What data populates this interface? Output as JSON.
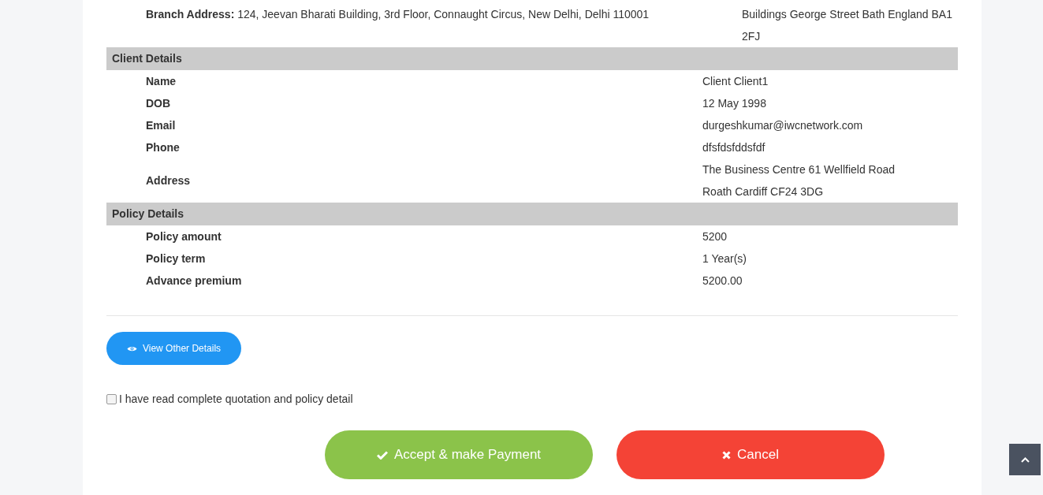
{
  "branch": {
    "label": "Branch Address:",
    "value": "124, Jeevan Bharati Building, 3rd Floor, Connaught Circus, New Delhi, Delhi 110001",
    "value_2": "Buildings George Street Bath England BA1 2FJ"
  },
  "sections": [
    {
      "title": "Client Details",
      "rows": [
        {
          "label": "Name",
          "value": "Client Client1"
        },
        {
          "label": "DOB",
          "value": "12 May 1998"
        },
        {
          "label": "Email",
          "value": "durgeshkumar@iwcnetwork.com"
        },
        {
          "label": "Phone",
          "value": "dfsfdsfddsfdf"
        },
        {
          "label": "Address",
          "value": "The Business Centre 61 Wellfield Road Roath Cardiff CF24 3DG"
        }
      ]
    },
    {
      "title": "Policy Details",
      "rows": [
        {
          "label": "Policy amount",
          "value": "5200"
        },
        {
          "label": "Policy term",
          "value": "1 Year(s)"
        },
        {
          "label": "Advance premium",
          "value": "5200.00"
        }
      ]
    }
  ],
  "view_button": {
    "label": "View Other Details"
  },
  "agreement": {
    "label": "I have read complete quotation and policy detail",
    "checked": false
  },
  "actions": [
    {
      "kind": "accept",
      "label": "Accept & make Payment"
    },
    {
      "kind": "cancel",
      "label": "Cancel"
    }
  ]
}
